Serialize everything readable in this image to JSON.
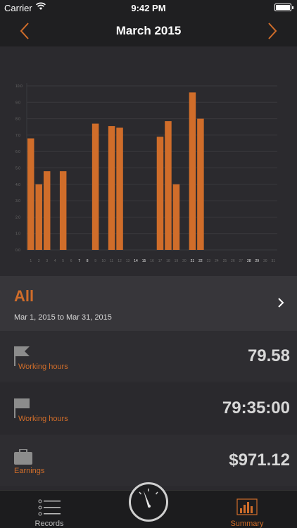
{
  "status_bar": {
    "carrier": "Carrier",
    "time": "9:42 PM"
  },
  "nav": {
    "title": "March 2015",
    "prev_icon": "chevron-left-icon",
    "next_icon": "chevron-right-icon"
  },
  "chart_data": {
    "type": "bar",
    "categories": [
      "1",
      "2",
      "3",
      "4",
      "5",
      "6",
      "7",
      "8",
      "9",
      "10",
      "11",
      "12",
      "13",
      "14",
      "15",
      "16",
      "17",
      "18",
      "19",
      "20",
      "21",
      "22",
      "23",
      "24",
      "25",
      "26",
      "27",
      "28",
      "29",
      "30",
      "31"
    ],
    "values": [
      6.8,
      4.0,
      4.8,
      0,
      4.8,
      0,
      0,
      0,
      7.7,
      0,
      7.55,
      7.45,
      0,
      0,
      0,
      0,
      6.9,
      7.85,
      4.0,
      0,
      9.6,
      8.0,
      0,
      0,
      0,
      0,
      0,
      0,
      0,
      0,
      0
    ],
    "highlighted_days": [
      "7",
      "8",
      "14",
      "15",
      "21",
      "22",
      "28",
      "29"
    ],
    "y_ticks": [
      "0.0",
      "1.0",
      "2.0",
      "3.0",
      "4.0",
      "5.0",
      "6.0",
      "7.0",
      "8.0",
      "9.0",
      "10.0"
    ],
    "ylim": [
      0,
      10
    ],
    "grid": true,
    "bar_color": "#d06d2a"
  },
  "period": {
    "name": "All",
    "range": "Mar 1, 2015 to Mar 31, 2015"
  },
  "stats": [
    {
      "label": "Working hours",
      "value": "79.58",
      "icon": "flag-icon"
    },
    {
      "label": "Working hours",
      "value": "79:35:00",
      "icon": "flag-icon"
    },
    {
      "label": "Earnings",
      "value": "$971.12",
      "icon": "briefcase-icon"
    }
  ],
  "tabs": {
    "records": "Records",
    "summary": "Summary"
  },
  "colors": {
    "accent": "#d06d2a",
    "background": "#2b2a2e",
    "bar_background": "#1f1f21"
  }
}
